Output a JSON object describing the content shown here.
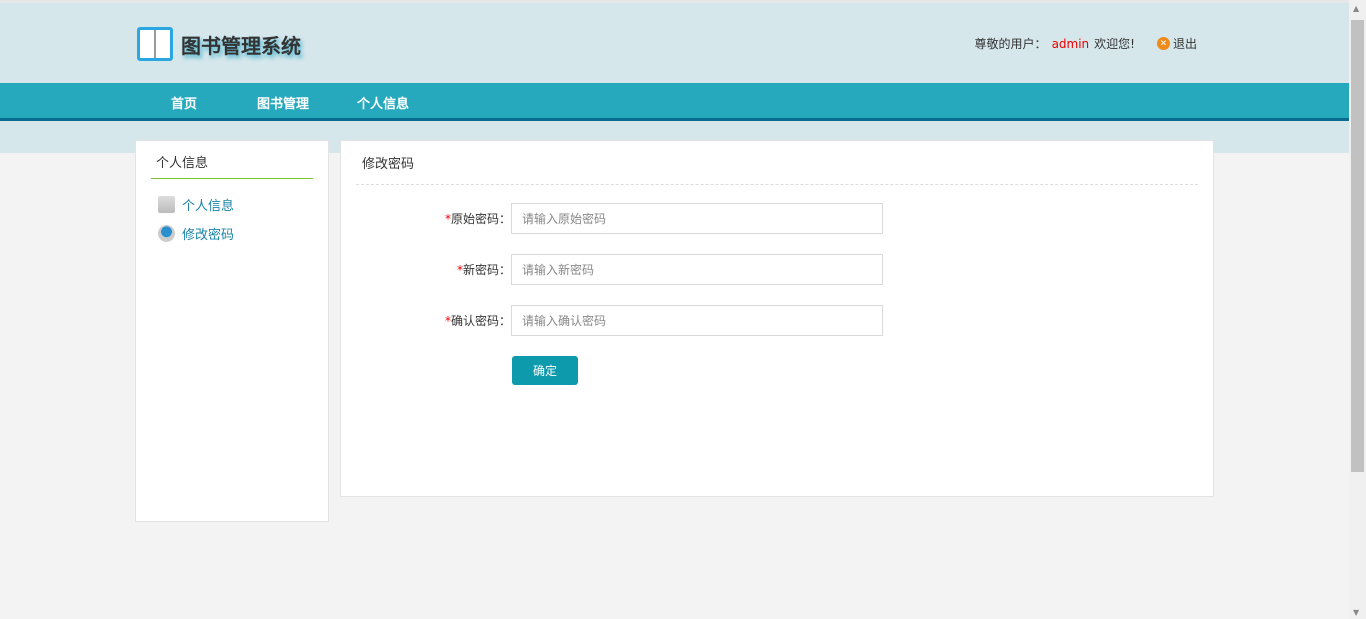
{
  "header": {
    "title": "图书管理系统",
    "greeting": "尊敬的用户：",
    "username": "admin",
    "welcome": "欢迎您!",
    "logout": "退出"
  },
  "nav": [
    "首页",
    "图书管理",
    "个人信息"
  ],
  "sidebar": {
    "title": "个人信息",
    "items": [
      {
        "label": "个人信息",
        "icon": "profile-list-icon"
      },
      {
        "label": "修改密码",
        "icon": "user-password-icon"
      }
    ]
  },
  "main": {
    "title": "修改密码",
    "fields": [
      {
        "label": "原始密码：",
        "placeholder": "请输入原始密码",
        "value": ""
      },
      {
        "label": "新密码：",
        "placeholder": "请输入新密码",
        "value": ""
      },
      {
        "label": "确认密码：",
        "placeholder": "请输入确认密码",
        "value": ""
      }
    ],
    "required_mark": "*",
    "submit": "确定"
  },
  "colors": {
    "nav": "#27a9bd",
    "header_bg": "#d6e7ec",
    "button": "#0e9aad",
    "username": "#ee0000"
  }
}
